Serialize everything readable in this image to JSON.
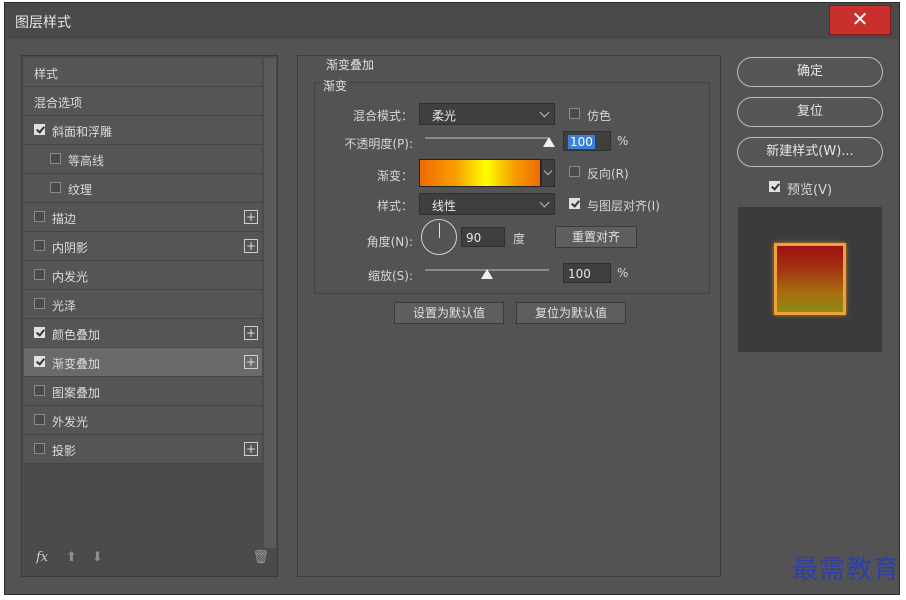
{
  "window": {
    "title": "图层样式",
    "close_glyph": "✕"
  },
  "sidebar": {
    "items": [
      {
        "label": "样式",
        "checkbox": false,
        "checked": false,
        "plus": false,
        "indent": 0
      },
      {
        "label": "混合选项",
        "checkbox": false,
        "checked": false,
        "plus": false,
        "indent": 0
      },
      {
        "label": "斜面和浮雕",
        "checkbox": true,
        "checked": true,
        "plus": false,
        "indent": 0
      },
      {
        "label": "等高线",
        "checkbox": true,
        "checked": false,
        "plus": false,
        "indent": 1
      },
      {
        "label": "纹理",
        "checkbox": true,
        "checked": false,
        "plus": false,
        "indent": 1
      },
      {
        "label": "描边",
        "checkbox": true,
        "checked": false,
        "plus": true,
        "indent": 0
      },
      {
        "label": "内阴影",
        "checkbox": true,
        "checked": false,
        "plus": true,
        "indent": 0
      },
      {
        "label": "内发光",
        "checkbox": true,
        "checked": false,
        "plus": false,
        "indent": 0
      },
      {
        "label": "光泽",
        "checkbox": true,
        "checked": false,
        "plus": false,
        "indent": 0
      },
      {
        "label": "颜色叠加",
        "checkbox": true,
        "checked": true,
        "plus": true,
        "indent": 0
      },
      {
        "label": "渐变叠加",
        "checkbox": true,
        "checked": true,
        "plus": true,
        "indent": 0,
        "selected": true
      },
      {
        "label": "图案叠加",
        "checkbox": true,
        "checked": false,
        "plus": false,
        "indent": 0
      },
      {
        "label": "外发光",
        "checkbox": true,
        "checked": false,
        "plus": false,
        "indent": 0
      },
      {
        "label": "投影",
        "checkbox": true,
        "checked": false,
        "plus": true,
        "indent": 0
      }
    ],
    "plus_glyph": "+",
    "footer": {
      "fx": "fx",
      "up_glyph": "⬆",
      "down_glyph": "⬇",
      "trash_glyph": "🗑"
    }
  },
  "panel": {
    "section_title": "渐变叠加",
    "group_title": "渐变",
    "blend_mode": {
      "label": "混合模式：",
      "value": "柔光"
    },
    "dither": {
      "label": "仿色",
      "checked": false
    },
    "opacity": {
      "label": "不透明度(P):",
      "value": "100",
      "unit": "%",
      "level": 1.0
    },
    "gradient": {
      "label": "渐变：",
      "colors": [
        "#f06a00",
        "#ffff00",
        "#f06a00"
      ]
    },
    "reverse": {
      "label": "反向(R)",
      "checked": false
    },
    "style": {
      "label": "样式：",
      "value": "线性"
    },
    "align_layer": {
      "label": "与图层对齐(I)",
      "checked": true
    },
    "angle": {
      "label": "角度(N):",
      "value": "90",
      "unit": "度"
    },
    "reset_align": "重置对齐",
    "scale": {
      "label": "缩放(S):",
      "value": "100",
      "unit": "%",
      "level": 0.5
    },
    "set_default": "设置为默认值",
    "reset_default": "复位为默认值"
  },
  "actions": {
    "ok": "确定",
    "reset": "复位",
    "new_style": "新建样式(W)...",
    "preview": {
      "label": "预览(V)",
      "checked": true
    }
  },
  "watermark": "最需教育"
}
